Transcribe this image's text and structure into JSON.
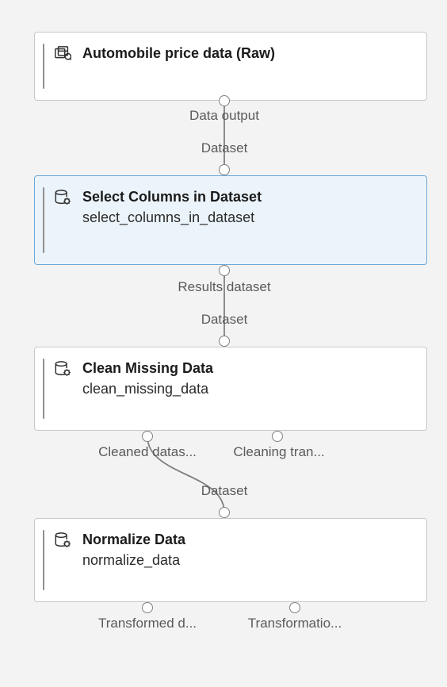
{
  "nodes": {
    "n1": {
      "title": "Automobile price data (Raw)",
      "icon": "dataset-icon",
      "outputs": [
        {
          "label_top": "Data output",
          "label_bottom": "Dataset"
        }
      ]
    },
    "n2": {
      "title": "Select Columns in Dataset",
      "subtitle": "select_columns_in_dataset",
      "icon": "db-gear-icon",
      "selected": true,
      "outputs": [
        {
          "label_top": "Results dataset",
          "label_bottom": "Dataset"
        }
      ]
    },
    "n3": {
      "title": "Clean Missing Data",
      "subtitle": "clean_missing_data",
      "icon": "db-gear-icon",
      "outputs": [
        {
          "label_top": "Cleaned datas...",
          "label_bottom": "Dataset"
        },
        {
          "label_top": "Cleaning tran..."
        }
      ]
    },
    "n4": {
      "title": "Normalize Data",
      "subtitle": "normalize_data",
      "icon": "db-gear-icon",
      "outputs": [
        {
          "label_top": "Transformed d..."
        },
        {
          "label_top": "Transformatio..."
        }
      ]
    }
  }
}
